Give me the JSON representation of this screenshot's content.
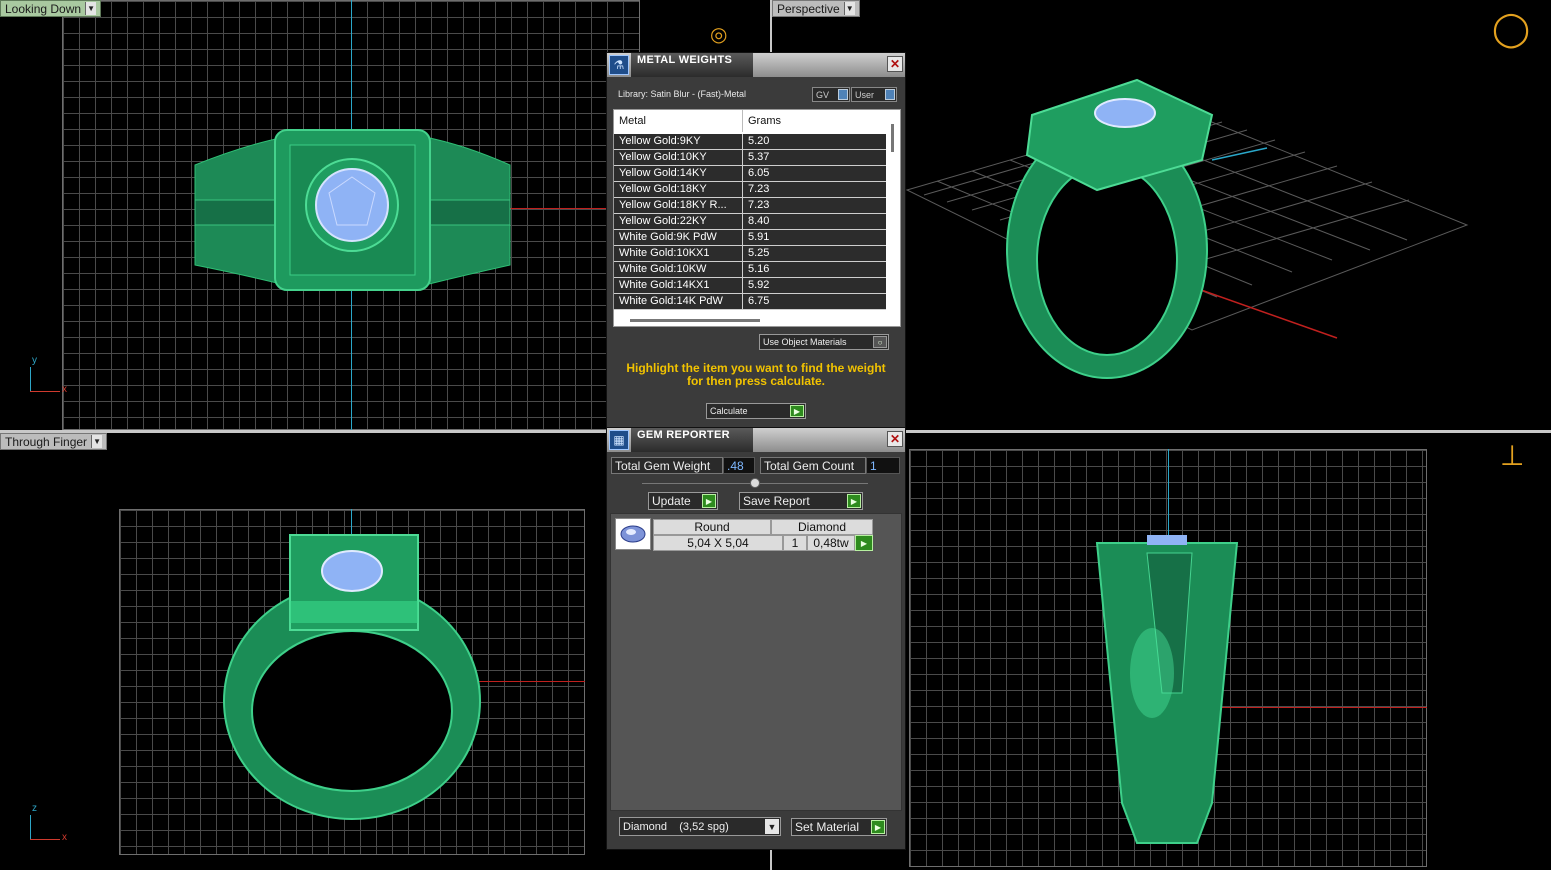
{
  "viewports": {
    "top_left": {
      "label": "Looking Down",
      "axis_y": "y",
      "axis_x": "x"
    },
    "top_right": {
      "label": "Perspective"
    },
    "bottom_left": {
      "label": "Through Finger",
      "axis_y": "z",
      "axis_x": "x"
    },
    "bottom_right": {
      "label": ""
    }
  },
  "metal_weights": {
    "title": "METAL WEIGHTS",
    "library": "Library: Satin Blur - (Fast)-Metal",
    "toggle_gv": "GV",
    "toggle_user": "User",
    "columns": {
      "metal": "Metal",
      "grams": "Grams"
    },
    "rows": [
      {
        "metal": "Yellow Gold:9KY",
        "grams": "5.20"
      },
      {
        "metal": "Yellow Gold:10KY",
        "grams": "5.37"
      },
      {
        "metal": "Yellow Gold:14KY",
        "grams": "6.05"
      },
      {
        "metal": "Yellow Gold:18KY",
        "grams": "7.23"
      },
      {
        "metal": "Yellow Gold:18KY R...",
        "grams": "7.23"
      },
      {
        "metal": "Yellow Gold:22KY",
        "grams": "8.40"
      },
      {
        "metal": "White Gold:9K PdW",
        "grams": "5.91"
      },
      {
        "metal": "White Gold:10KX1",
        "grams": "5.25"
      },
      {
        "metal": "White Gold:10KW",
        "grams": "5.16"
      },
      {
        "metal": "White Gold:14KX1",
        "grams": "5.92"
      },
      {
        "metal": "White Gold:14K PdW",
        "grams": "6.75"
      }
    ],
    "use_object_materials": "Use Object Materials",
    "hint_line1": "Highlight the item you want to find the weight",
    "hint_line2": "for then press calculate.",
    "calculate": "Calculate"
  },
  "gem_reporter": {
    "title": "GEM REPORTER",
    "total_weight_label": "Total Gem Weight",
    "total_weight_value": ".48",
    "total_count_label": "Total Gem Count",
    "total_count_value": "1",
    "update": "Update",
    "save_report": "Save Report",
    "gem": {
      "shape": "Round",
      "type": "Diamond",
      "size": "5,04 X 5,04",
      "count": "1",
      "weight": "0,48tw"
    },
    "material_select": "Diamond    (3,52 spg)",
    "set_material": "Set Material"
  },
  "colors": {
    "ring_green": "#1f8a55",
    "ring_green_light": "#2fae6c",
    "gem_blue": "#8fb3f5",
    "hint_yellow": "#f2c300",
    "accent_green_button": "#2e8b1e"
  }
}
